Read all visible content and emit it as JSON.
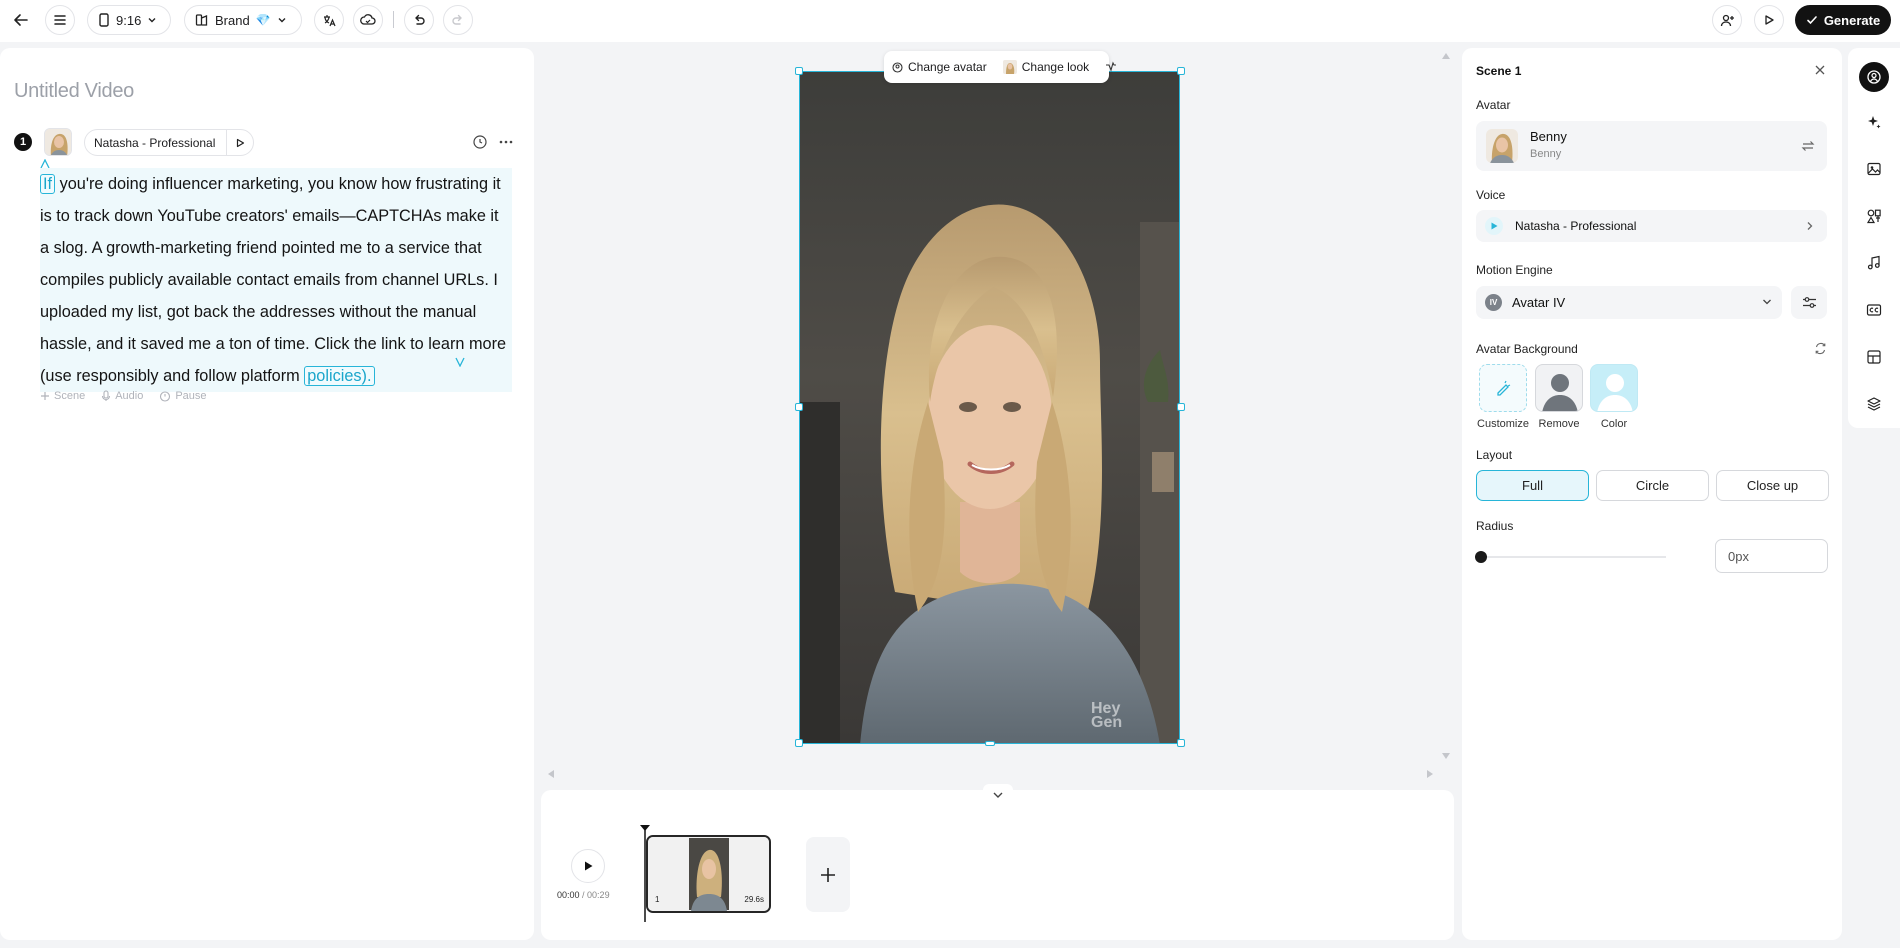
{
  "topbar": {
    "aspect_ratio": "9:16",
    "brand_label": "Brand",
    "brand_emoji": "💎",
    "generate_label": "Generate"
  },
  "script": {
    "title": "Untitled Video",
    "scene_number": "1",
    "voice_name": "Natasha - Professional",
    "first_word": "If",
    "text_body": " you're doing influencer marketing, you know how frustrating it is to track down YouTube creators' emails—CAPTCHAs make it a slog. A growth-marketing friend pointed me to a service that compiles publicly available contact emails from channel URLs. I uploaded my list, got back the addresses without the manual hassle, and it saved me a ton of time. Click the link to learn more (use responsibly and follow platform ",
    "last_word": "policies).",
    "tools": {
      "scene": "Scene",
      "audio": "Audio",
      "pause": "Pause"
    }
  },
  "canvas": {
    "change_avatar": "Change avatar",
    "change_look": "Change look",
    "watermark": "Hey Gen"
  },
  "timeline": {
    "current_time": "00:00",
    "total_time": "/ 00:29",
    "clip_index": "1",
    "clip_duration": "29.6s"
  },
  "properties": {
    "scene_title": "Scene 1",
    "avatar_label": "Avatar",
    "avatar_name": "Benny",
    "avatar_sub": "Benny",
    "voice_label": "Voice",
    "voice_name": "Natasha - Professional",
    "motion_label": "Motion Engine",
    "motion_value": "Avatar IV",
    "motion_badge": "IV",
    "background_label": "Avatar Background",
    "background_options": [
      "Customize",
      "Remove",
      "Color"
    ],
    "layout_label": "Layout",
    "layout_options": [
      "Full",
      "Circle",
      "Close up"
    ],
    "layout_selected": "Full",
    "radius_label": "Radius",
    "radius_value": "0px",
    "radius_slider_fraction": 0
  },
  "colors": {
    "accent": "#27b5d8",
    "primary_button": "#121212",
    "selection_bg": "#e6f6fb"
  }
}
